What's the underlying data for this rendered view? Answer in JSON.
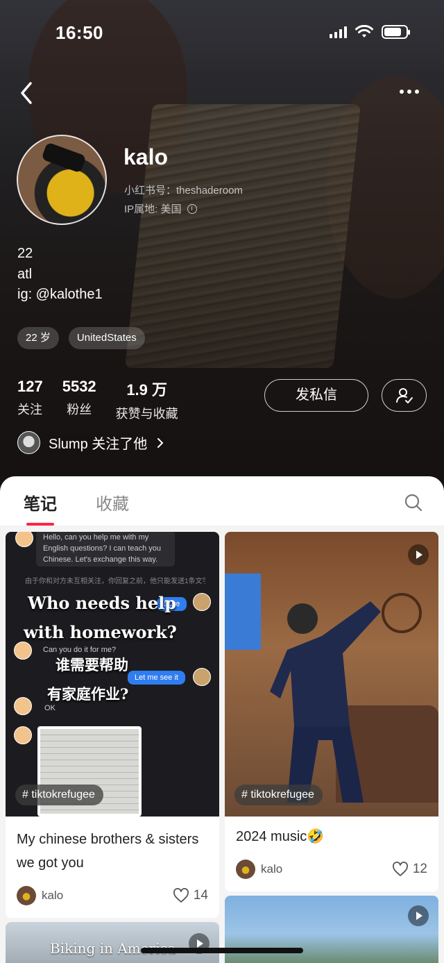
{
  "status_bar": {
    "time": "16:50"
  },
  "profile": {
    "name": "kalo",
    "red_id_label": "小红书号：",
    "red_id": "theshaderoom",
    "ip_label": "IP属地: 美国",
    "bio_lines": [
      "22",
      "atl",
      "ig: @kalothe1"
    ],
    "tags": [
      "22 岁",
      "UnitedStates"
    ],
    "stats": [
      {
        "value": "127",
        "label": "关注"
      },
      {
        "value": "5532",
        "label": "粉丝"
      },
      {
        "value": "1.9 万",
        "label": "获赞与收藏"
      }
    ],
    "message_button": "发私信",
    "mutual_text": "Slump 关注了他"
  },
  "tabs": {
    "notes": "笔记",
    "collections": "收藏"
  },
  "posts": [
    {
      "hashtag": "tiktokrefugee",
      "title": "My chinese brothers & sisters we got you",
      "author": "kalo",
      "likes": "14",
      "cover_text": {
        "chat1": "Hello, can you help me with my English questions? I can teach you Chinese. Let's exchange this way.",
        "chat_small": "由于你和对方未互相关注，你回复之前，他只能发送1条文字消息",
        "bubble_sure": "Sure",
        "caption_en_1": "Who needs help",
        "caption_en_2": "with homework?",
        "chat2": "Can you do it for me?",
        "caption_zh_1": "谁需要帮助",
        "bubble_see": "Let me see it",
        "caption_zh_2": "有家庭作业?",
        "chat_ok": "OK"
      }
    },
    {
      "hashtag": "tiktokrefugee",
      "title": "2024 music🤣",
      "author": "kalo",
      "likes": "12"
    },
    {
      "cover_text": "Biking in America"
    },
    {}
  ]
}
